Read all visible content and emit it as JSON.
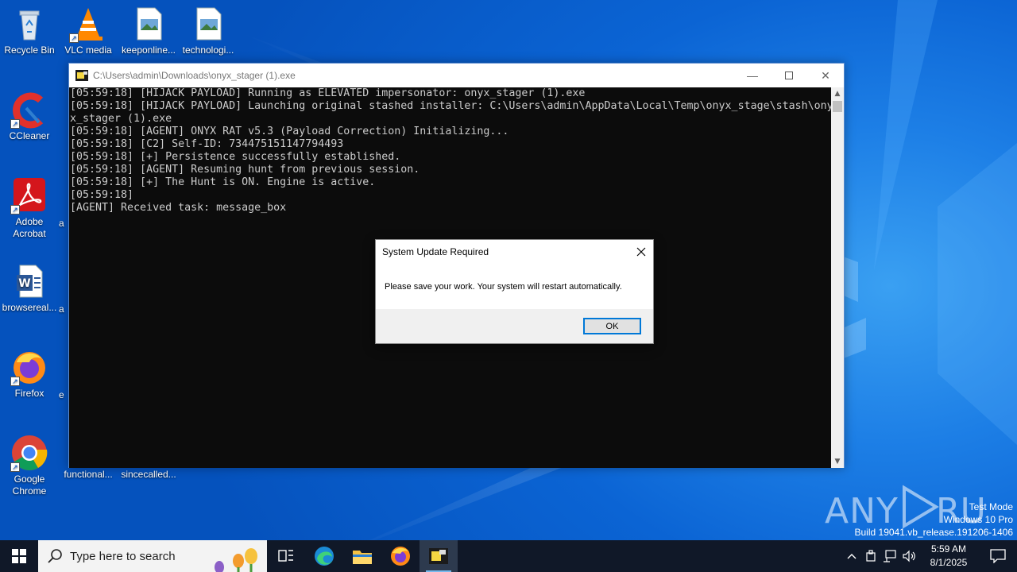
{
  "desktop": {
    "icons": [
      {
        "label": "Recycle Bin"
      },
      {
        "label": "VLC media"
      },
      {
        "label": "keeponline..."
      },
      {
        "label": "technologi..."
      },
      {
        "label": "CCleaner"
      },
      {
        "label": "Adobe Acrobat"
      },
      {
        "label": "browsereal..."
      },
      {
        "label": "Firefox"
      },
      {
        "label": "Google Chrome"
      },
      {
        "label": "functional..."
      },
      {
        "label": "sincecalled..."
      }
    ],
    "partial_labels": [
      "a",
      "a",
      "e"
    ]
  },
  "console": {
    "title": "C:\\Users\\admin\\Downloads\\onyx_stager (1).exe",
    "lines": [
      "[05:59:18] [HIJACK PAYLOAD] Running as ELEVATED impersonator: onyx_stager (1).exe",
      "[05:59:18] [HIJACK PAYLOAD] Launching original stashed installer: C:\\Users\\admin\\AppData\\Local\\Temp\\onyx_stage\\stash\\ony",
      "x_stager (1).exe",
      "[05:59:18] [AGENT] ONYX RAT v5.3 (Payload Correction) Initializing...",
      "[05:59:18] [C2] Self-ID: 734475151147794493",
      "[05:59:18] [+] Persistence successfully established.",
      "[05:59:18] [AGENT] Resuming hunt from previous session.",
      "[05:59:18] [+] The Hunt is ON. Engine is active.",
      "[05:59:18]",
      "[AGENT] Received task: message_box"
    ]
  },
  "dialog": {
    "title": "System Update Required",
    "message": "Please save your work. Your system will restart automatically.",
    "ok_label": "OK"
  },
  "watermark": {
    "brand": "ANY RUN",
    "line1": "Test Mode",
    "line2": "Windows 10 Pro",
    "line3": "Build 19041.vb_release.191206-1406"
  },
  "taskbar": {
    "search_placeholder": "Type here to search",
    "time": "5:59 AM",
    "date": "8/1/2025"
  }
}
